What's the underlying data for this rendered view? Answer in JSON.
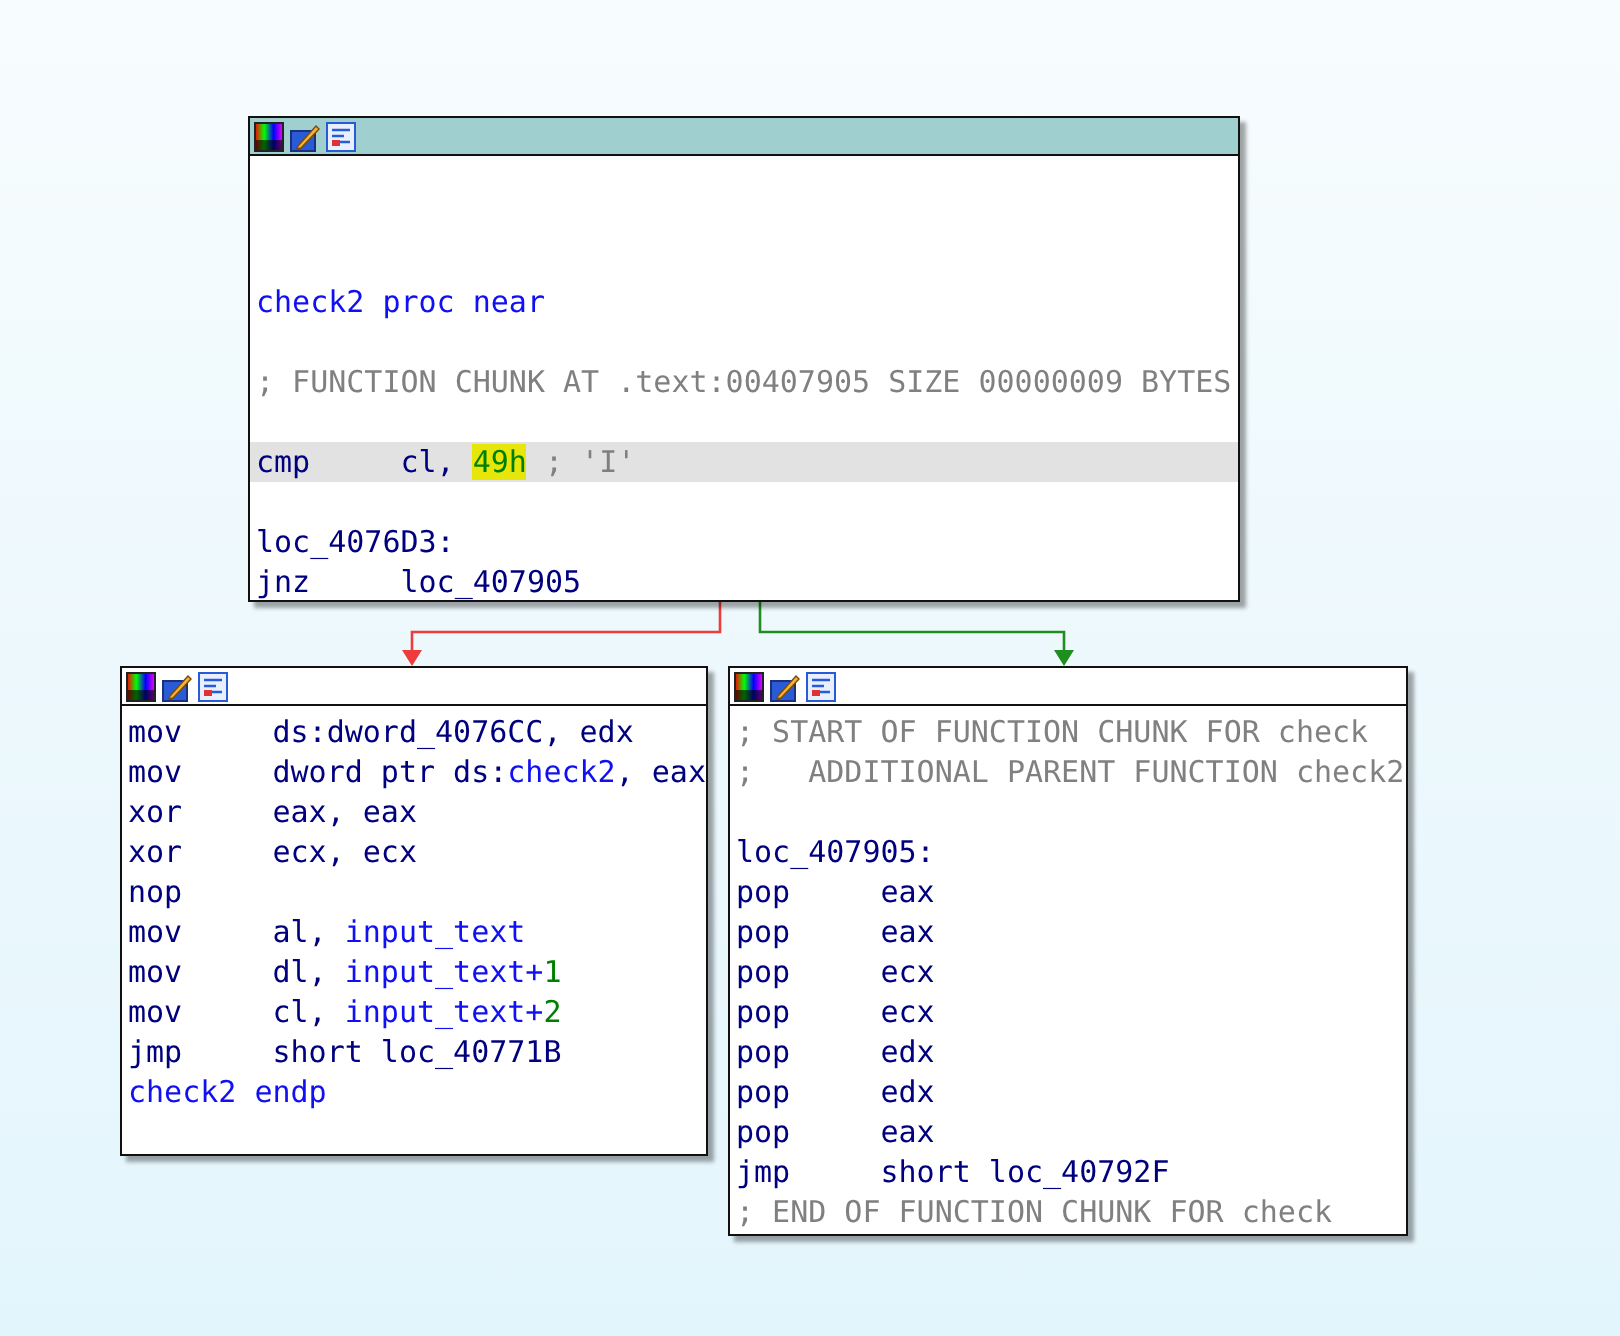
{
  "nodes": [
    {
      "selected": true,
      "lines": [
        {
          "kind": "blank",
          "selected": false
        },
        {
          "kind": "blank",
          "selected": false
        },
        {
          "kind": "blank",
          "selected": false
        },
        {
          "kind": "text",
          "selected": false,
          "tokens": [
            {
              "text": "check2 proc near",
              "kind": "name"
            }
          ]
        },
        {
          "kind": "blank",
          "selected": false
        },
        {
          "kind": "text",
          "selected": false,
          "tokens": [
            {
              "text": "; FUNCTION CHUNK AT .text:00407905 SIZE 00000009 BYTES",
              "kind": "comment"
            }
          ]
        },
        {
          "kind": "blank",
          "selected": false
        },
        {
          "kind": "instr",
          "selected": true,
          "mnemonic": "cmp",
          "tokens": [
            {
              "text": "cl, ",
              "kind": "operand"
            },
            {
              "text": "49h",
              "kind": "search-hit"
            },
            {
              "text": " ; 'I'",
              "kind": "comment"
            }
          ]
        },
        {
          "kind": "blank",
          "selected": false
        },
        {
          "kind": "text",
          "selected": false,
          "tokens": [
            {
              "text": "loc_4076D3:",
              "kind": "operand"
            }
          ]
        },
        {
          "kind": "instr",
          "selected": false,
          "mnemonic": "jnz",
          "tokens": [
            {
              "text": "loc_407905",
              "kind": "operand"
            }
          ]
        }
      ]
    },
    {
      "selected": false,
      "lines": [
        {
          "kind": "instr",
          "selected": false,
          "mnemonic": "mov",
          "tokens": [
            {
              "text": "ds:dword_4076CC, edx",
              "kind": "operand"
            }
          ]
        },
        {
          "kind": "instr",
          "selected": false,
          "mnemonic": "mov",
          "tokens": [
            {
              "text": "dword ptr ds:",
              "kind": "operand"
            },
            {
              "text": "check2",
              "kind": "name"
            },
            {
              "text": ", eax",
              "kind": "operand"
            }
          ]
        },
        {
          "kind": "instr",
          "selected": false,
          "mnemonic": "xor",
          "tokens": [
            {
              "text": "eax, eax",
              "kind": "operand"
            }
          ]
        },
        {
          "kind": "instr",
          "selected": false,
          "mnemonic": "xor",
          "tokens": [
            {
              "text": "ecx, ecx",
              "kind": "operand"
            }
          ]
        },
        {
          "kind": "instr",
          "selected": false,
          "mnemonic": "nop"
        },
        {
          "kind": "instr",
          "selected": false,
          "mnemonic": "mov",
          "tokens": [
            {
              "text": "al, ",
              "kind": "operand"
            },
            {
              "text": "input_text",
              "kind": "name"
            }
          ]
        },
        {
          "kind": "instr",
          "selected": false,
          "mnemonic": "mov",
          "tokens": [
            {
              "text": "dl, ",
              "kind": "operand"
            },
            {
              "text": "input_text+",
              "kind": "name"
            },
            {
              "text": "1",
              "kind": "number"
            }
          ]
        },
        {
          "kind": "instr",
          "selected": false,
          "mnemonic": "mov",
          "tokens": [
            {
              "text": "cl, ",
              "kind": "operand"
            },
            {
              "text": "input_text+",
              "kind": "name"
            },
            {
              "text": "2",
              "kind": "number"
            }
          ]
        },
        {
          "kind": "instr",
          "selected": false,
          "mnemonic": "jmp",
          "tokens": [
            {
              "text": "short loc_40771B",
              "kind": "operand"
            }
          ]
        },
        {
          "kind": "text",
          "selected": false,
          "tokens": [
            {
              "text": "check2 endp",
              "kind": "name"
            }
          ]
        }
      ]
    },
    {
      "selected": false,
      "lines": [
        {
          "kind": "text",
          "selected": false,
          "tokens": [
            {
              "text": "; START OF FUNCTION CHUNK FOR check",
              "kind": "comment"
            }
          ]
        },
        {
          "kind": "text",
          "selected": false,
          "tokens": [
            {
              "text": ";   ADDITIONAL PARENT FUNCTION check2",
              "kind": "comment"
            }
          ]
        },
        {
          "kind": "blank",
          "selected": false
        },
        {
          "kind": "text",
          "selected": false,
          "tokens": [
            {
              "text": "loc_407905:",
              "kind": "operand"
            }
          ]
        },
        {
          "kind": "instr",
          "selected": false,
          "mnemonic": "pop",
          "tokens": [
            {
              "text": "eax",
              "kind": "operand"
            }
          ]
        },
        {
          "kind": "instr",
          "selected": false,
          "mnemonic": "pop",
          "tokens": [
            {
              "text": "eax",
              "kind": "operand"
            }
          ]
        },
        {
          "kind": "instr",
          "selected": false,
          "mnemonic": "pop",
          "tokens": [
            {
              "text": "ecx",
              "kind": "operand"
            }
          ]
        },
        {
          "kind": "instr",
          "selected": false,
          "mnemonic": "pop",
          "tokens": [
            {
              "text": "ecx",
              "kind": "operand"
            }
          ]
        },
        {
          "kind": "instr",
          "selected": false,
          "mnemonic": "pop",
          "tokens": [
            {
              "text": "edx",
              "kind": "operand"
            }
          ]
        },
        {
          "kind": "instr",
          "selected": false,
          "mnemonic": "pop",
          "tokens": [
            {
              "text": "edx",
              "kind": "operand"
            }
          ]
        },
        {
          "kind": "instr",
          "selected": false,
          "mnemonic": "pop",
          "tokens": [
            {
              "text": "eax",
              "kind": "operand"
            }
          ]
        },
        {
          "kind": "instr",
          "selected": false,
          "mnemonic": "jmp",
          "tokens": [
            {
              "text": "short loc_40792F",
              "kind": "operand"
            }
          ]
        },
        {
          "kind": "text",
          "selected": false,
          "tokens": [
            {
              "text": "; END OF FUNCTION CHUNK FOR check",
              "kind": "comment"
            }
          ]
        }
      ]
    }
  ],
  "edges": [
    {
      "kind": "not-taken"
    },
    {
      "kind": "taken"
    }
  ]
}
